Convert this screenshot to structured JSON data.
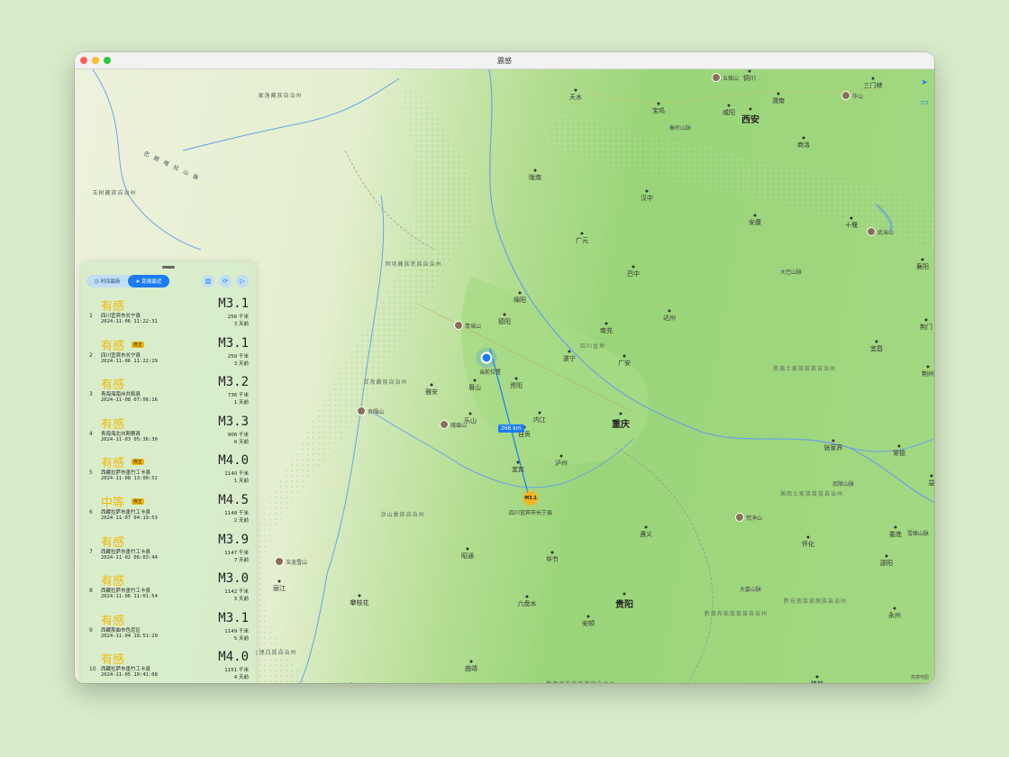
{
  "window": {
    "title": "震感"
  },
  "map": {
    "current_location_label": "当前位置",
    "distance_label": "266 km",
    "quake_marker_label": "M3.1",
    "quake_place_label": "四川宜宾市长宁县",
    "legal": "高德地图",
    "cities": [
      {
        "name": "铜川",
        "big": false
      },
      {
        "name": "西安",
        "big": true
      },
      {
        "name": "渭南",
        "big": false
      },
      {
        "name": "咸阳",
        "big": false
      },
      {
        "name": "宝鸡",
        "big": false
      },
      {
        "name": "天水",
        "big": false
      },
      {
        "name": "三门峡",
        "big": false
      },
      {
        "name": "商洛",
        "big": false
      },
      {
        "name": "陇南",
        "big": false
      },
      {
        "name": "汉中",
        "big": false
      },
      {
        "name": "安康",
        "big": false
      },
      {
        "name": "十堰",
        "big": false
      },
      {
        "name": "广元",
        "big": false
      },
      {
        "name": "巴中",
        "big": false
      },
      {
        "name": "襄阳",
        "big": false
      },
      {
        "name": "绵阳",
        "big": false
      },
      {
        "name": "德阳",
        "big": false
      },
      {
        "name": "南充",
        "big": false
      },
      {
        "name": "达州",
        "big": false
      },
      {
        "name": "遂宁",
        "big": false
      },
      {
        "name": "广安",
        "big": false
      },
      {
        "name": "荆门",
        "big": false
      },
      {
        "name": "眉山",
        "big": false
      },
      {
        "name": "资阳",
        "big": false
      },
      {
        "name": "雅安",
        "big": false
      },
      {
        "name": "宜昌",
        "big": false
      },
      {
        "name": "荆州",
        "big": false
      },
      {
        "name": "重庆",
        "big": true
      },
      {
        "name": "乐山",
        "big": false
      },
      {
        "name": "内江",
        "big": false
      },
      {
        "name": "自贡",
        "big": false
      },
      {
        "name": "泸州",
        "big": false
      },
      {
        "name": "宜宾",
        "big": false
      },
      {
        "name": "张家界",
        "big": false
      },
      {
        "name": "常德",
        "big": false
      },
      {
        "name": "益",
        "big": false
      },
      {
        "name": "遵义",
        "big": false
      },
      {
        "name": "怀化",
        "big": false
      },
      {
        "name": "娄底",
        "big": false
      },
      {
        "name": "昭通",
        "big": false
      },
      {
        "name": "毕节",
        "big": false
      },
      {
        "name": "邵阳",
        "big": false
      },
      {
        "name": "丽江",
        "big": false
      },
      {
        "name": "攀枝花",
        "big": false
      },
      {
        "name": "六盘水",
        "big": false
      },
      {
        "name": "贵阳",
        "big": true
      },
      {
        "name": "安顺",
        "big": false
      },
      {
        "name": "永州",
        "big": false
      },
      {
        "name": "曲靖",
        "big": false
      },
      {
        "name": "桂林",
        "big": false
      }
    ],
    "regions": [
      "果洛藏族自治州",
      "玉树藏族自治州",
      "阿坝藏族羌族自治州",
      "甘孜藏族自治州",
      "恩施土家族苗族自治州",
      "湘西土家族苗族自治州",
      "凉山彝族自治州",
      "黔东南苗族侗族自治州",
      "黔南布依族苗族自治州",
      "大理白族自治州",
      "黔西南布依族苗族自治州",
      "楚雄彝族自治州",
      "四川盆地"
    ],
    "mountains": [
      "巴颜喀拉山脉",
      "秦岭山脉",
      "大巴山脉",
      "武陵山脉",
      "雪峰山脉",
      "大娄山脉"
    ],
    "pois": [
      "五稜山",
      "华山",
      "武当山",
      "青城山",
      "峨眉山",
      "贡嘎山",
      "梵净山",
      "玉龙雪山"
    ]
  },
  "panel": {
    "seg_time": "时间最新",
    "seg_distance": "距离最近",
    "earthquakes": [
      {
        "idx": "1",
        "level": "有感",
        "tag": "",
        "place": "四川宜宾市长宁县",
        "time": "2024-11-06 11:22:31",
        "mag": "M3.1",
        "dist": "256 千米",
        "ago": "3 天前"
      },
      {
        "idx": "2",
        "level": "有感",
        "tag": "修正",
        "place": "四川宜宾市长宁县",
        "time": "2024-11-06 11:22:29",
        "mag": "M3.1",
        "dist": "259 千米",
        "ago": "3 天前"
      },
      {
        "idx": "3",
        "level": "有感",
        "tag": "",
        "place": "青海海南州共和县",
        "time": "2024-11-08 07:06:16",
        "mag": "M3.2",
        "dist": "736 千米",
        "ago": "1 天前"
      },
      {
        "idx": "4",
        "level": "有感",
        "tag": "",
        "place": "青海海北州刚察县",
        "time": "2024-11-03 05:36:30",
        "mag": "M3.3",
        "dist": "906 千米",
        "ago": "6 天前"
      },
      {
        "idx": "5",
        "level": "有感",
        "tag": "修正",
        "place": "西藏拉萨市墨竹工卡县",
        "time": "2024-11-08 13:00:52",
        "mag": "M4.0",
        "dist": "1140 千米",
        "ago": "1 天前"
      },
      {
        "idx": "6",
        "level": "中等",
        "tag": "修正",
        "place": "西藏拉萨市墨竹工卡县",
        "time": "2024-11-07 04:19:53",
        "mag": "M4.5",
        "dist": "1148 千米",
        "ago": "2 天前"
      },
      {
        "idx": "7",
        "level": "有感",
        "tag": "",
        "place": "西藏拉萨市墨竹工卡县",
        "time": "2024-11-02 06:03:44",
        "mag": "M3.9",
        "dist": "1147 千米",
        "ago": "7 天前"
      },
      {
        "idx": "8",
        "level": "有感",
        "tag": "",
        "place": "西藏拉萨市墨竹工卡县",
        "time": "2024-11-06 11:01:54",
        "mag": "M3.0",
        "dist": "1142 千米",
        "ago": "3 天前"
      },
      {
        "idx": "9",
        "level": "有感",
        "tag": "",
        "place": "西藏那曲市色尼区",
        "time": "2024-11-04 18:51:29",
        "mag": "M3.1",
        "dist": "1149 千米",
        "ago": "5 天前"
      },
      {
        "idx": "10",
        "level": "有感",
        "tag": "",
        "place": "西藏拉萨市墨竹工卡县",
        "time": "2024-11-05 10:41:08",
        "mag": "M4.0",
        "dist": "1151 千米",
        "ago": "4 天前"
      }
    ]
  },
  "colors": {
    "accent": "#1a7cf4",
    "level_felt": "#f2b705",
    "map_green": "#9ad57a"
  },
  "icons": [
    "clock-icon",
    "location-arrow-icon",
    "chart-icon",
    "refresh-icon",
    "play-icon",
    "compass-arrow-icon",
    "map-mode-icon"
  ]
}
